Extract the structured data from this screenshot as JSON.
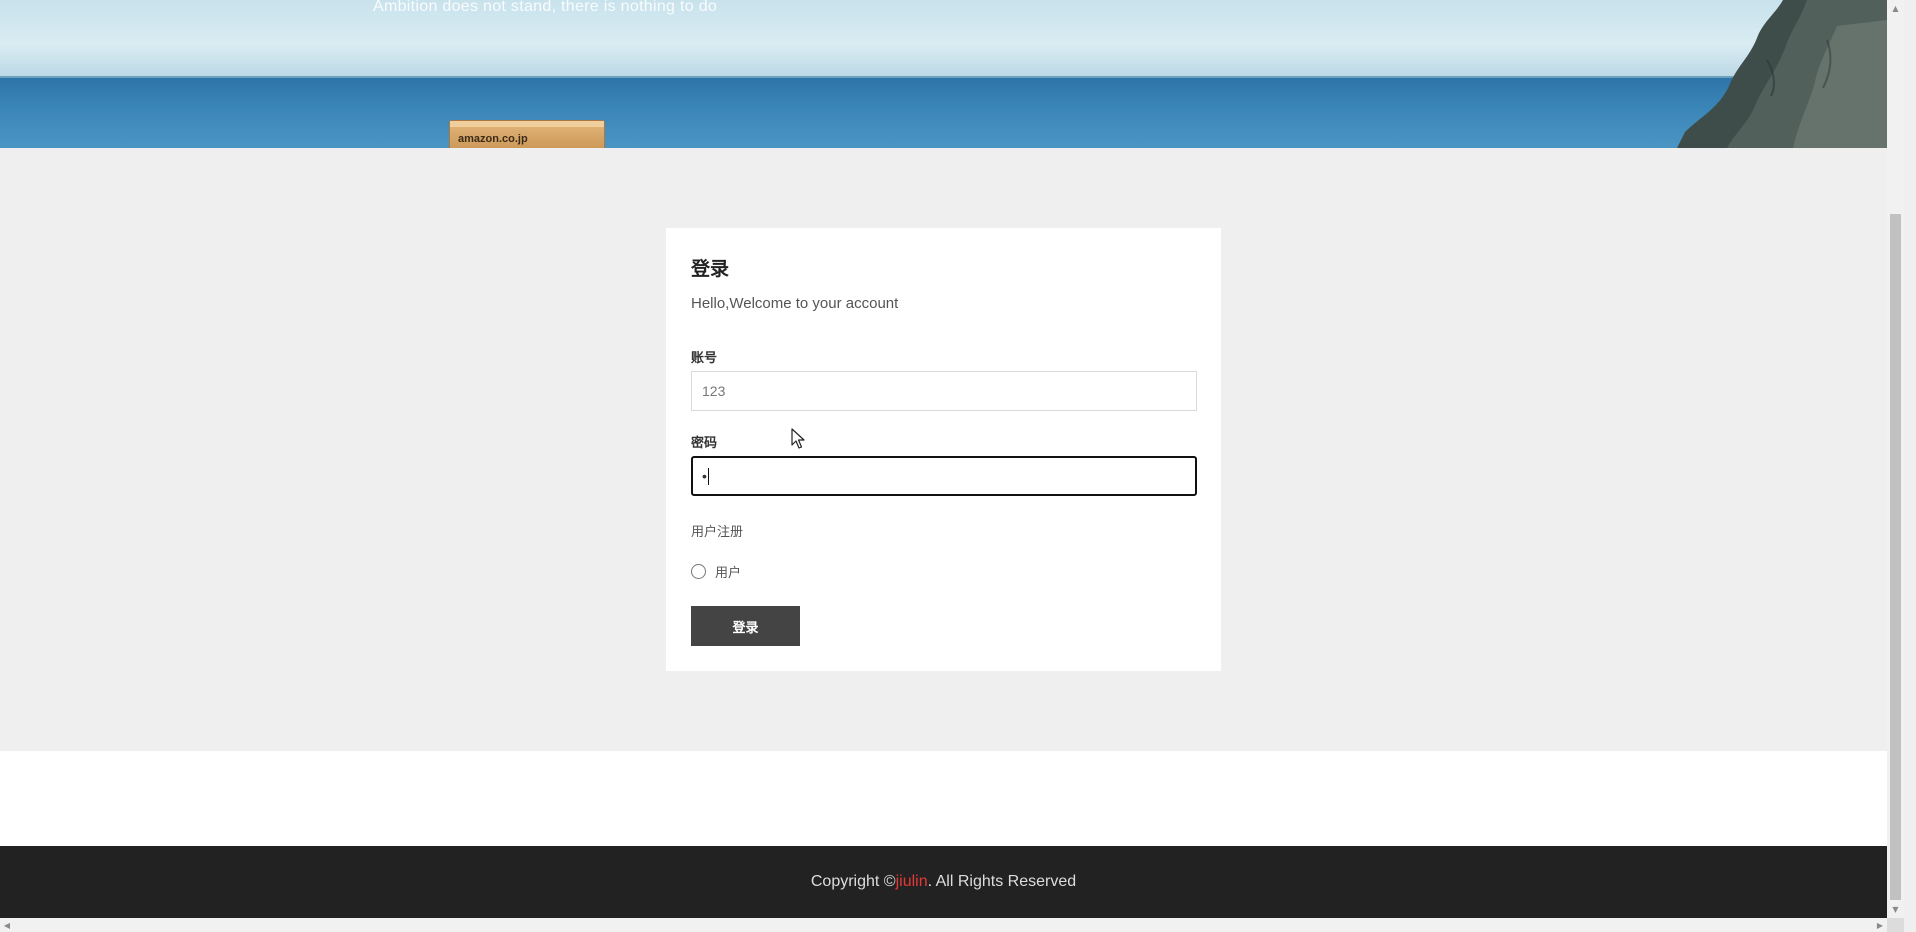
{
  "hero": {
    "tagline": "Ambition does not stand, there is nothing to do",
    "box_label": "amazon.co.jp"
  },
  "login": {
    "title": "登录",
    "subtitle": "Hello,Welcome to your account",
    "account_label": "账号",
    "account_value": "123",
    "password_label": "密码",
    "password_value": "•",
    "register_label": "用户注册",
    "radio_user_label": "用户",
    "radio_user_checked": false,
    "submit_label": "登录"
  },
  "footer": {
    "prefix": "Copyright © ",
    "brand": "jiulin",
    "suffix": ". All Rights Reserved",
    "brand_color": "#e53935"
  },
  "icons": {
    "cursor": "mouse-pointer-icon",
    "scroll_up": "chevron-up-icon",
    "scroll_down": "chevron-down-icon",
    "scroll_left": "chevron-left-icon",
    "scroll_right": "chevron-right-icon"
  }
}
